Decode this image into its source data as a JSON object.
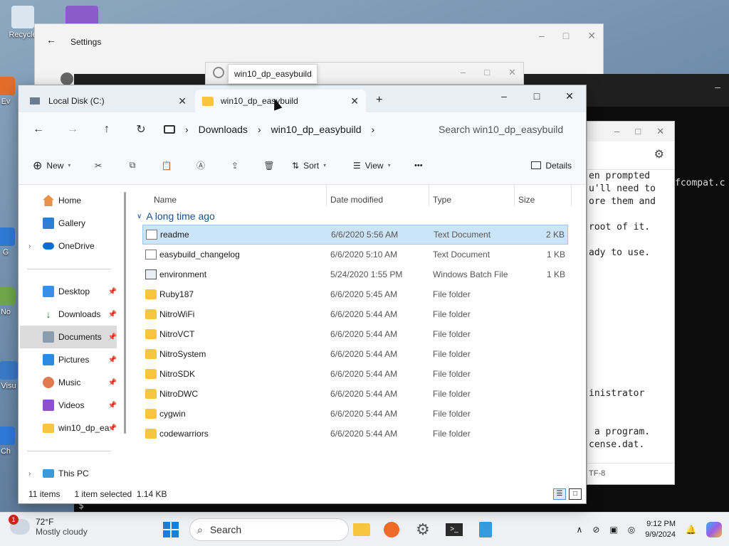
{
  "desktop": {
    "icons": [
      {
        "label": "Recycle",
        "icon": "recycle-bin-icon"
      },
      {
        "label": "Ev",
        "icon": "app-icon"
      },
      {
        "label": "G",
        "icon": "app-icon"
      },
      {
        "label": "No",
        "icon": "app-icon"
      },
      {
        "label": "Visu",
        "icon": "app-icon"
      },
      {
        "label": "Ch",
        "icon": "app-icon"
      }
    ]
  },
  "settings_window": {
    "title": "Settings"
  },
  "tooltip": {
    "text": "win10_dp_easybuild"
  },
  "notepad": {
    "lines": [
      "en prompted",
      "u'll need to",
      "ore them and",
      "",
      "root of it.",
      "",
      "ady to use.",
      "",
      "",
      "",
      "",
      "",
      "",
      "",
      "",
      "",
      "",
      "inistrator",
      "",
      "",
      " a program.",
      "cense.dat."
    ],
    "status": "TF-8"
  },
  "terminal": {
    "right_text": "fcompat.c",
    "prompt": "$"
  },
  "explorer": {
    "tabs": [
      {
        "label": "Local Disk (C:)",
        "icon": "drive-icon"
      },
      {
        "label": "win10_dp_easybuild",
        "icon": "folder-icon"
      }
    ],
    "new_tab": "+",
    "breadcrumb": [
      "Downloads",
      "win10_dp_easybuild"
    ],
    "search_placeholder": "Search win10_dp_easybuild",
    "commands": {
      "new": "New",
      "sort": "Sort",
      "view": "View",
      "more": "•••",
      "details": "Details"
    },
    "sidebar": {
      "top": [
        {
          "label": "Home",
          "icon": "home-icon"
        },
        {
          "label": "Gallery",
          "icon": "gallery-icon"
        },
        {
          "label": "OneDrive",
          "icon": "cloud-icon"
        }
      ],
      "quick": [
        {
          "label": "Desktop",
          "icon": "desktop-icon",
          "pinned": true
        },
        {
          "label": "Downloads",
          "icon": "download-icon",
          "pinned": true
        },
        {
          "label": "Documents",
          "icon": "documents-icon",
          "pinned": true
        },
        {
          "label": "Pictures",
          "icon": "pictures-icon",
          "pinned": true
        },
        {
          "label": "Music",
          "icon": "music-icon",
          "pinned": true
        },
        {
          "label": "Videos",
          "icon": "videos-icon",
          "pinned": true
        },
        {
          "label": "win10_dp_ea",
          "icon": "folder-icon",
          "pinned": true
        }
      ],
      "this_pc": "This PC"
    },
    "columns": {
      "name": "Name",
      "date": "Date modified",
      "type": "Type",
      "size": "Size"
    },
    "group_label": "A long time ago",
    "files": [
      {
        "name": "readme",
        "date": "6/6/2020 5:56 AM",
        "type": "Text Document",
        "size": "2 KB",
        "kind": "doc",
        "selected": true
      },
      {
        "name": "easybuild_changelog",
        "date": "6/6/2020 5:10 AM",
        "type": "Text Document",
        "size": "1 KB",
        "kind": "doc"
      },
      {
        "name": "environment",
        "date": "5/24/2020 1:55 PM",
        "type": "Windows Batch File",
        "size": "1 KB",
        "kind": "batch"
      },
      {
        "name": "Ruby187",
        "date": "6/6/2020 5:45 AM",
        "type": "File folder",
        "size": "",
        "kind": "folder"
      },
      {
        "name": "NitroWiFi",
        "date": "6/6/2020 5:44 AM",
        "type": "File folder",
        "size": "",
        "kind": "folder"
      },
      {
        "name": "NitroVCT",
        "date": "6/6/2020 5:44 AM",
        "type": "File folder",
        "size": "",
        "kind": "folder"
      },
      {
        "name": "NitroSystem",
        "date": "6/6/2020 5:44 AM",
        "type": "File folder",
        "size": "",
        "kind": "folder"
      },
      {
        "name": "NitroSDK",
        "date": "6/6/2020 5:44 AM",
        "type": "File folder",
        "size": "",
        "kind": "folder"
      },
      {
        "name": "NitroDWC",
        "date": "6/6/2020 5:44 AM",
        "type": "File folder",
        "size": "",
        "kind": "folder"
      },
      {
        "name": "cygwin",
        "date": "6/6/2020 5:44 AM",
        "type": "File folder",
        "size": "",
        "kind": "folder"
      },
      {
        "name": "codewarriors",
        "date": "6/6/2020 5:44 AM",
        "type": "File folder",
        "size": "",
        "kind": "folder"
      }
    ],
    "status": {
      "count": "11 items",
      "selected": "1 item selected  1.14 KB"
    }
  },
  "taskbar": {
    "weather_temp": "72°F",
    "weather_desc": "Mostly cloudy",
    "weather_badge": "1",
    "search_label": "Search",
    "time": "9:12 PM",
    "date": "9/9/2024"
  },
  "colors": {
    "accent": "#0067c0",
    "selection": "#cce4f7",
    "folder": "#f8c53e"
  }
}
